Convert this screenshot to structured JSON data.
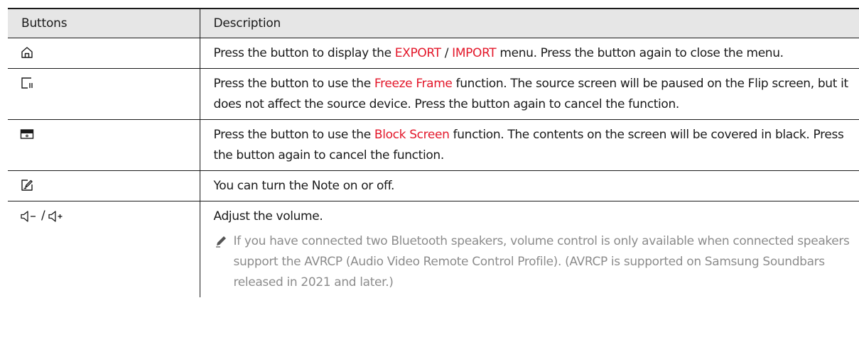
{
  "table": {
    "headers": {
      "buttons": "Buttons",
      "description": "Description"
    },
    "rows": [
      {
        "icon": "home-icon",
        "desc_before": "Press the button to display the ",
        "hl1": "EXPORT",
        "sep": " / ",
        "hl2": "IMPORT",
        "desc_after": " menu. Press the button again to close the menu."
      },
      {
        "icon": "freeze-frame-icon",
        "desc_before": "Press the button to use the ",
        "hl1": "Freeze Frame",
        "desc_after": " function. The source screen will be paused on the Flip screen, but it does not affect the source device. Press the button again to cancel the function."
      },
      {
        "icon": "block-screen-icon",
        "desc_before": "Press the button to use the ",
        "hl1": "Block Screen",
        "desc_after": " function. The contents on the screen will be covered in black. Press the button again to cancel the function."
      },
      {
        "icon": "note-icon",
        "desc": "You can turn the Note on or off."
      },
      {
        "icons": [
          "volume-down-icon",
          "volume-up-icon"
        ],
        "icon_separator": "/",
        "desc": "Adjust the volume.",
        "note_icon": "pencil-icon",
        "note": "If you have connected two Bluetooth speakers, volume control is only available when connected speakers support the AVRCP (Audio Video Remote Control Profile). (AVRCP is supported on Samsung Soundbars released in 2021 and later.)"
      }
    ]
  },
  "colors": {
    "highlight": "#e3172a",
    "header_bg": "#e6e6e6",
    "note_text": "#8c8c8c",
    "text": "#1a1a1a"
  }
}
